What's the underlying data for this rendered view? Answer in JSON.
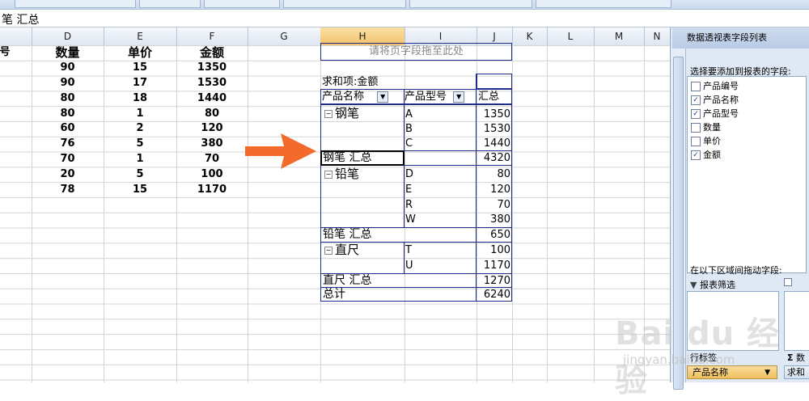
{
  "formula_bar": {
    "content": "笔 汇总"
  },
  "columns": [
    "D",
    "E",
    "F",
    "G",
    "H",
    "I",
    "J",
    "K",
    "L",
    "M",
    "N"
  ],
  "selected_column": "H",
  "source_table": {
    "header_partial": "号",
    "headers": [
      "数量",
      "单价",
      "金额"
    ],
    "rows": [
      [
        "90",
        "15",
        "1350"
      ],
      [
        "90",
        "17",
        "1530"
      ],
      [
        "80",
        "18",
        "1440"
      ],
      [
        "80",
        "1",
        "80"
      ],
      [
        "60",
        "2",
        "120"
      ],
      [
        "76",
        "5",
        "380"
      ],
      [
        "70",
        "1",
        "70"
      ],
      [
        "20",
        "5",
        "100"
      ],
      [
        "78",
        "15",
        "1170"
      ]
    ]
  },
  "pivot": {
    "page_drop_hint": "请将页字段拖至此处",
    "data_label": "求和项:金额",
    "header_product_name": "产品名称",
    "header_product_model": "产品型号",
    "header_total": "汇总",
    "groups": [
      {
        "name": "钢笔",
        "items": [
          [
            "A",
            "1350"
          ],
          [
            "B",
            "1530"
          ],
          [
            "C",
            "1440"
          ]
        ],
        "subtotal_label": "钢笔 汇总",
        "subtotal": "4320"
      },
      {
        "name": "铅笔",
        "items": [
          [
            "D",
            "80"
          ],
          [
            "E",
            "120"
          ],
          [
            "R",
            "70"
          ],
          [
            "W",
            "380"
          ]
        ],
        "subtotal_label": "铅笔 汇总",
        "subtotal": "650"
      },
      {
        "name": "直尺",
        "items": [
          [
            "T",
            "100"
          ],
          [
            "U",
            "1170"
          ]
        ],
        "subtotal_label": "直尺 汇总",
        "subtotal": "1270"
      }
    ],
    "grand_total_label": "总计",
    "grand_total": "6240"
  },
  "panel": {
    "title": "数据透视表字段列表",
    "choose_label": "选择要添加到报表的字段:",
    "fields": [
      {
        "label": "产品编号",
        "checked": false
      },
      {
        "label": "产品名称",
        "checked": true
      },
      {
        "label": "产品型号",
        "checked": true
      },
      {
        "label": "数量",
        "checked": false
      },
      {
        "label": "单价",
        "checked": false
      },
      {
        "label": "金额",
        "checked": true
      }
    ],
    "drag_label": "在以下区域间拖动字段:",
    "filter_label": "报表筛选",
    "row_label_partial": "行标签",
    "values_label_partial": "数",
    "row_field": "产品名称",
    "value_field_partial": "求和"
  },
  "colors": {
    "accent_arrow": "#f26b2c",
    "pivot_border": "#1f2d8a"
  },
  "watermark": {
    "brand": "Bai du 经验",
    "url": "jingyan.baidu.com"
  }
}
